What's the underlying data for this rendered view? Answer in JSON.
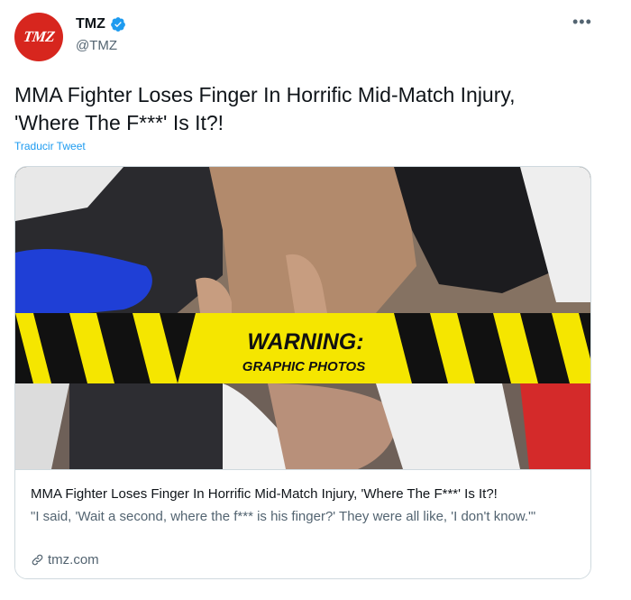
{
  "account": {
    "name": "TMZ",
    "handle": "@TMZ",
    "avatar_text": "TMZ",
    "verified": true
  },
  "tweet": {
    "text_line1": "MMA Fighter Loses Finger In Horrific Mid-Match Injury,",
    "text_line2": "'Where The F***' Is It?!",
    "translate_label": "Traducir Tweet"
  },
  "card": {
    "warning_title": "WARNING:",
    "warning_subtitle": "GRAPHIC PHOTOS",
    "title": "MMA Fighter Loses Finger In Horrific Mid-Match Injury, 'Where The F***' Is It?!",
    "description": "\"I said, 'Wait a second, where the f*** is his finger?' They were all like, 'I don't know.'\"",
    "domain": "tmz.com"
  },
  "icons": {
    "more": "more-options-icon",
    "verified": "verified-badge-icon",
    "link": "link-icon"
  },
  "colors": {
    "brand_red": "#d7261e",
    "twitter_blue": "#1d9bf0",
    "warning_yellow": "#f5e600"
  }
}
